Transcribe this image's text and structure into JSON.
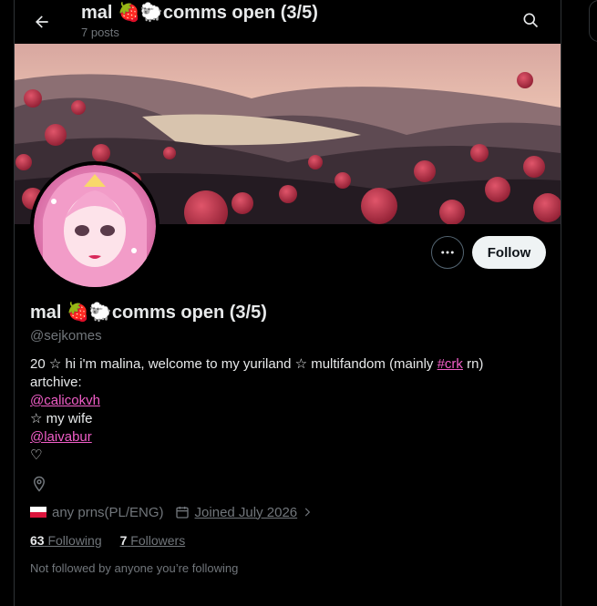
{
  "header": {
    "title": "mal 🍓🐑comms open (3/5)",
    "post_count": "7 posts"
  },
  "profile": {
    "name": "mal 🍓🐑comms open (3/5)",
    "handle": "@sejkomes",
    "follow_label": "Follow",
    "bio": {
      "line1_before": "20 ☆ hi i'm malina, welcome to my yuriland ☆ multifandom (mainly ",
      "line1_link": "#crk",
      "line1_after": " rn)",
      "line2": "artchive:",
      "line3_link": "@calicokvh",
      "line4": " ☆ my wife",
      "line5_link": "@laivabur",
      "line6": "♡"
    },
    "pronouns": "any prns(PL/ENG)",
    "joined": "Joined July 2026",
    "following_count": "63",
    "following_label": "Following",
    "followers_count": "7",
    "followers_label": "Followers",
    "not_followed_text": "Not followed by anyone you’re following"
  },
  "colors": {
    "accent_pink": "#f15ec8",
    "secondary_text": "#71767b",
    "follow_bg": "#eff3f4"
  },
  "icons": [
    "back-arrow-icon",
    "search-icon",
    "more-icon",
    "location-icon",
    "poland-flag-icon",
    "calendar-icon",
    "chevron-right-icon"
  ]
}
